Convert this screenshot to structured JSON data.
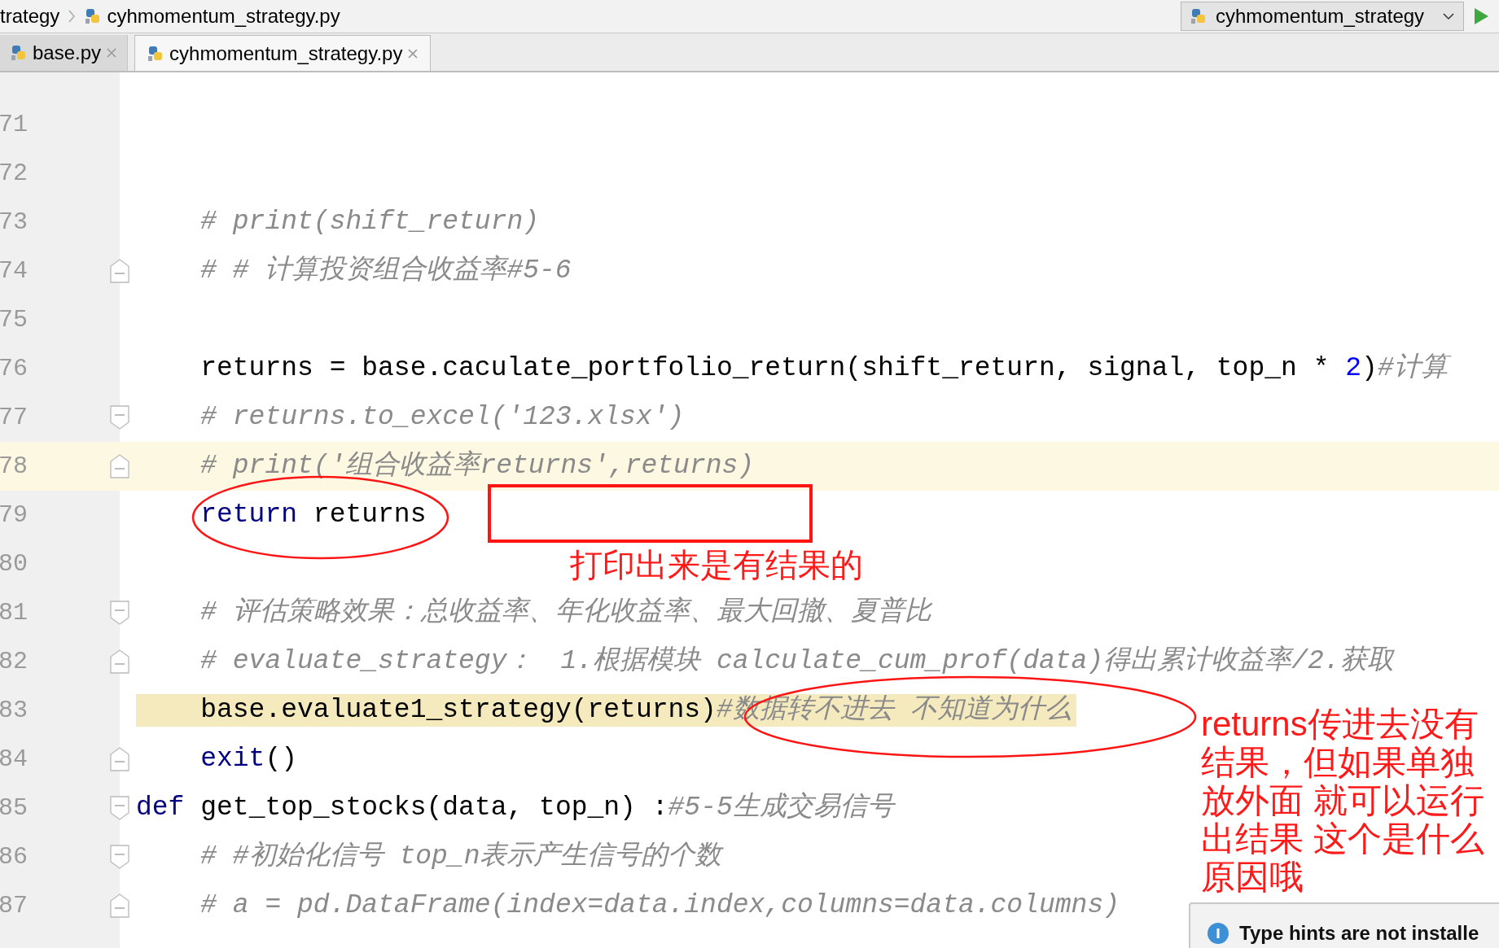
{
  "breadcrumb": {
    "items": [
      {
        "label": "trategy",
        "icon": false
      },
      {
        "label": "cyhmomentum_strategy.py",
        "icon": true
      }
    ]
  },
  "run_config": {
    "label": "cyhmomentum_strategy"
  },
  "tabs": [
    {
      "label": "base.py",
      "selected": false
    },
    {
      "label": "cyhmomentum_strategy.py",
      "selected": true
    }
  ],
  "lines": [
    {
      "number": "71"
    },
    {
      "number": "72"
    },
    {
      "number": "73",
      "code": [
        {
          "kind": "comment",
          "text": "    # print(shift_return)"
        }
      ]
    },
    {
      "number": "74",
      "fold": {
        "kind": "end"
      },
      "code": [
        {
          "kind": "comment",
          "text": "    # # 计算投资组合收益率#5-6"
        }
      ]
    },
    {
      "number": "75"
    },
    {
      "number": "76",
      "code": [
        {
          "kind": "plain",
          "text": "    returns = base.caculate_portfolio_return(shift_return, signal, top_n * "
        },
        {
          "kind": "number",
          "text": "2"
        },
        {
          "kind": "plain",
          "text": ")"
        },
        {
          "kind": "comment",
          "text": "#计算"
        }
      ]
    },
    {
      "number": "77",
      "fold": {
        "kind": "start"
      },
      "code": [
        {
          "kind": "comment",
          "text": "    # returns.to_excel('123.xlsx')"
        }
      ]
    },
    {
      "number": "78",
      "fold": {
        "kind": "end"
      },
      "current": true,
      "code": [
        {
          "kind": "comment",
          "text": "    # print('组合收益率returns',returns)"
        }
      ]
    },
    {
      "number": "79",
      "code": [
        {
          "kind": "keyword",
          "text": "    return"
        },
        {
          "kind": "plain",
          "text": " returns"
        }
      ]
    },
    {
      "number": "80"
    },
    {
      "number": "81",
      "fold": {
        "kind": "start"
      },
      "code": [
        {
          "kind": "comment",
          "text": "    # 评估策略效果：总收益率、年化收益率、最大回撤、夏普比"
        }
      ]
    },
    {
      "number": "82",
      "fold": {
        "kind": "end"
      },
      "code": [
        {
          "kind": "comment",
          "text": "    # evaluate_strategy：　1.根据模块 calculate_cum_prof(data)得出累计收益率/2.获取"
        }
      ]
    },
    {
      "number": "83",
      "warning": true,
      "code": [
        {
          "kind": "plain",
          "text": "    base.evaluate1_strategy(returns)"
        },
        {
          "kind": "comment",
          "text": "#数据转不进去 不知道为什么"
        }
      ]
    },
    {
      "number": "84",
      "fold": {
        "kind": "end"
      },
      "code": [
        {
          "kind": "keyword",
          "text": "    exit"
        },
        {
          "kind": "plain",
          "text": "()"
        }
      ]
    },
    {
      "number": "85",
      "fold": {
        "kind": "start"
      },
      "code": [
        {
          "kind": "keyword",
          "text": "def"
        },
        {
          "kind": "plain",
          "text": " get_top_stocks(data, top_n) :"
        },
        {
          "kind": "comment",
          "text": "#5-5生成交易信号"
        }
      ]
    },
    {
      "number": "86",
      "fold": {
        "kind": "start"
      },
      "code": [
        {
          "kind": "comment",
          "text": "    # #初始化信号 top_n表示产生信号的个数"
        }
      ]
    },
    {
      "number": "87",
      "fold": {
        "kind": "end"
      },
      "code": [
        {
          "kind": "comment",
          "text": "    # a = pd.DataFrame(index=data.index,columns=data.columns)"
        }
      ]
    }
  ],
  "annotations": [
    {
      "kind": "ellipse"
    },
    {
      "kind": "rect"
    },
    {
      "kind": "note",
      "lines": [
        "打印出来是有结果的"
      ]
    },
    {
      "kind": "ellipse"
    },
    {
      "kind": "note",
      "lines": [
        "returns传进去没有",
        "结果，但如果单独",
        "放外面 就可以运行",
        "出结果 这个是什么",
        "原因哦"
      ]
    }
  ],
  "notification": {
    "text": "Type hints are not installe"
  }
}
